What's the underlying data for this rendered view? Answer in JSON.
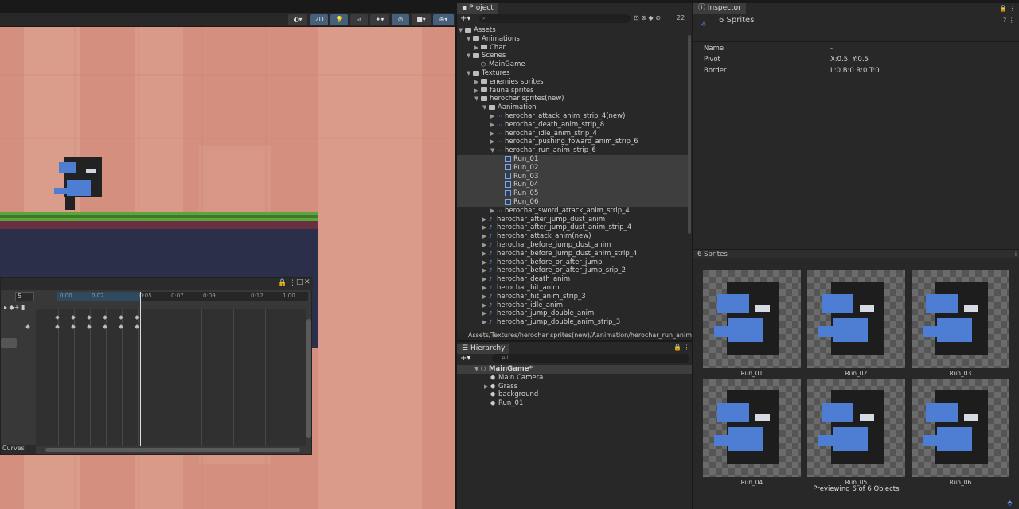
{
  "scene": {
    "toolbar": {
      "mode_2d": "2D"
    }
  },
  "animation": {
    "frame_value": "5",
    "time_ticks": [
      "0:00",
      "0:02",
      "0:05",
      "0:07",
      "0:09",
      "0:12",
      "1:00"
    ],
    "curves_label": "Curves"
  },
  "project": {
    "tab_label": "Project",
    "asset_count": "22",
    "path": "Assets/Textures/herochar sprites(new)/Aanimation/herochar_run_anim_str",
    "tree": [
      {
        "label": "Assets",
        "depth": 0,
        "type": "folder",
        "arrow": "▼"
      },
      {
        "label": "Animations",
        "depth": 1,
        "type": "folder",
        "arrow": "▼"
      },
      {
        "label": "Char",
        "depth": 2,
        "type": "folder",
        "arrow": "▶"
      },
      {
        "label": "Scenes",
        "depth": 1,
        "type": "folder",
        "arrow": "▼"
      },
      {
        "label": "MainGame",
        "depth": 2,
        "type": "scene",
        "arrow": ""
      },
      {
        "label": "Textures",
        "depth": 1,
        "type": "folder",
        "arrow": "▼"
      },
      {
        "label": "enemies sprites",
        "depth": 2,
        "type": "folder",
        "arrow": "▶"
      },
      {
        "label": "fauna sprites",
        "depth": 2,
        "type": "folder",
        "arrow": "▶"
      },
      {
        "label": "herochar sprites(new)",
        "depth": 2,
        "type": "folder",
        "arrow": "▼"
      },
      {
        "label": "Aanimation",
        "depth": 3,
        "type": "folder",
        "arrow": "▼"
      },
      {
        "label": "herochar_attack_anim_strip_4(new)",
        "depth": 4,
        "type": "strip",
        "arrow": "▶"
      },
      {
        "label": "herochar_death_anim_strip_8",
        "depth": 4,
        "type": "strip",
        "arrow": "▶"
      },
      {
        "label": "herochar_idle_anim_strip_4",
        "depth": 4,
        "type": "strip",
        "arrow": "▶"
      },
      {
        "label": "herochar_pushing_foward_anim_strip_6",
        "depth": 4,
        "type": "strip",
        "arrow": "▶"
      },
      {
        "label": "herochar_run_anim_strip_6",
        "depth": 4,
        "type": "strip",
        "arrow": "▼"
      },
      {
        "label": "Run_01",
        "depth": 5,
        "type": "sprite",
        "arrow": "",
        "selected": true
      },
      {
        "label": "Run_02",
        "depth": 5,
        "type": "sprite",
        "arrow": "",
        "selected": true
      },
      {
        "label": "Run_03",
        "depth": 5,
        "type": "sprite",
        "arrow": "",
        "selected": true
      },
      {
        "label": "Run_04",
        "depth": 5,
        "type": "sprite",
        "arrow": "",
        "selected": true
      },
      {
        "label": "Run_05",
        "depth": 5,
        "type": "sprite",
        "arrow": "",
        "selected": true
      },
      {
        "label": "Run_06",
        "depth": 5,
        "type": "sprite",
        "arrow": "",
        "selected": true
      },
      {
        "label": "herochar_sword_attack_anim_strip_4",
        "depth": 4,
        "type": "strip",
        "arrow": "▶"
      },
      {
        "label": "herochar_after_jump_dust_anim",
        "depth": 3,
        "type": "anim",
        "arrow": "▶"
      },
      {
        "label": "herochar_after_jump_dust_anim_strip_4",
        "depth": 3,
        "type": "anim",
        "arrow": "▶"
      },
      {
        "label": "herochar_attack_anim(new)",
        "depth": 3,
        "type": "anim",
        "arrow": "▶"
      },
      {
        "label": "herochar_before_jump_dust_anim",
        "depth": 3,
        "type": "anim",
        "arrow": "▶"
      },
      {
        "label": "herochar_before_jump_dust_anim_strip_4",
        "depth": 3,
        "type": "anim",
        "arrow": "▶"
      },
      {
        "label": "herochar_before_or_after_jump",
        "depth": 3,
        "type": "anim",
        "arrow": "▶"
      },
      {
        "label": "herochar_before_or_after_jump_srip_2",
        "depth": 3,
        "type": "anim",
        "arrow": "▶"
      },
      {
        "label": "herochar_death_anim",
        "depth": 3,
        "type": "anim",
        "arrow": "▶"
      },
      {
        "label": "herochar_hit_anim",
        "depth": 3,
        "type": "anim",
        "arrow": "▶"
      },
      {
        "label": "herochar_hit_anim_strip_3",
        "depth": 3,
        "type": "anim",
        "arrow": "▶"
      },
      {
        "label": "herochar_idle_anim",
        "depth": 3,
        "type": "anim",
        "arrow": "▶"
      },
      {
        "label": "herochar_jump_double_anim",
        "depth": 3,
        "type": "anim",
        "arrow": "▶"
      },
      {
        "label": "herochar_jump_double_anim_strip_3",
        "depth": 3,
        "type": "anim",
        "arrow": "▶"
      }
    ]
  },
  "hierarchy": {
    "tab_label": "Hierarchy",
    "search_placeholder": "All",
    "items": [
      {
        "label": "MainGame*",
        "depth": 0,
        "arrow": "▼",
        "bold": true
      },
      {
        "label": "Main Camera",
        "depth": 1,
        "arrow": ""
      },
      {
        "label": "Grass",
        "depth": 1,
        "arrow": "▶"
      },
      {
        "label": "background",
        "depth": 1,
        "arrow": ""
      },
      {
        "label": "Run_01",
        "depth": 1,
        "arrow": ""
      }
    ]
  },
  "inspector": {
    "tab_label": "Inspector",
    "title": "6 Sprites",
    "fields": [
      {
        "name": "Name",
        "value": "-"
      },
      {
        "name": "Pivot",
        "value": "X:0.5, Y:0.5"
      },
      {
        "name": "Border",
        "value": "L:0 B:0 R:0 T:0"
      }
    ],
    "preview_header": "6 Sprites",
    "thumbnails": [
      "Run_01",
      "Run_02",
      "Run_03",
      "Run_04",
      "Run_05",
      "Run_06"
    ],
    "preview_status": "Previewing 6 of 6 Objects"
  },
  "colors": {
    "scene_bg": "#d58f7e",
    "hero_blue": "#4d7ed3",
    "grass": "#5aa63a",
    "panel": "#282828"
  }
}
